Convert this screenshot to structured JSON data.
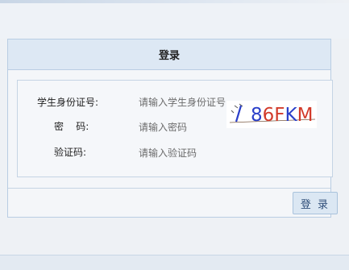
{
  "panel": {
    "title": "登录"
  },
  "form": {
    "student_id_label": "学生身份证号:",
    "student_id_placeholder": "请输入学生身份证号",
    "password_label": "密    码:",
    "password_placeholder": "请输入密码",
    "captcha_label": "验证码:",
    "captcha_placeholder": "请输入验证码",
    "captcha_text": "86FKM"
  },
  "actions": {
    "login_label": "登 录"
  },
  "colors": {
    "accent": "#2f4e79",
    "captcha_blue": "#2a3fc9",
    "captcha_red": "#d23a2a"
  }
}
